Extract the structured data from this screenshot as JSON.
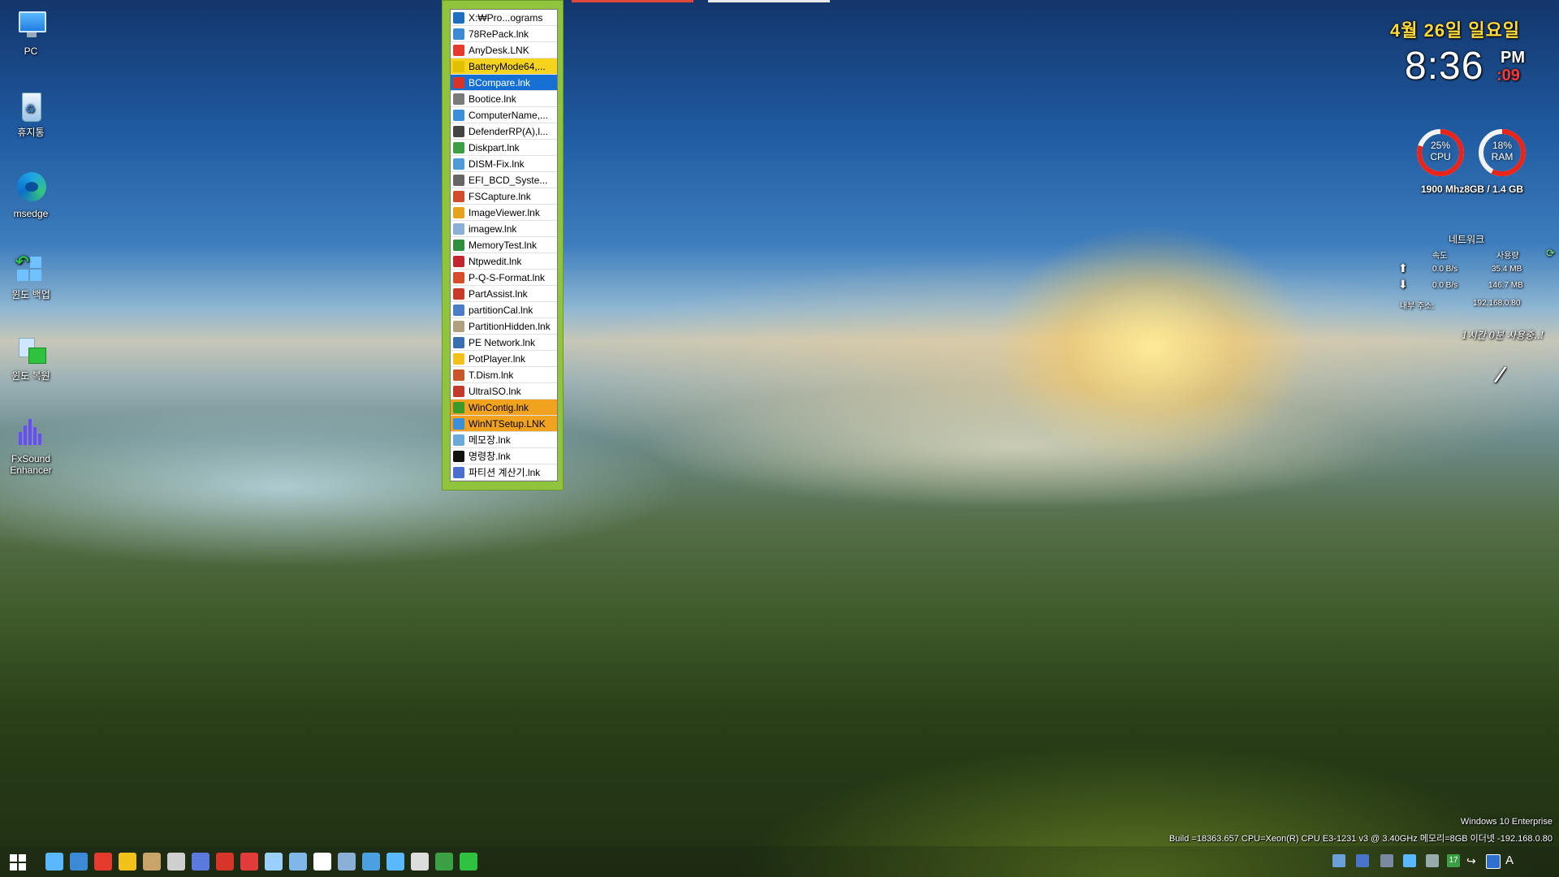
{
  "desktop_icons": [
    {
      "label": "PC",
      "icon": "computer-icon"
    },
    {
      "label": "휴지통",
      "icon": "recycle-bin-icon"
    },
    {
      "label": "msedge",
      "icon": "edge-icon"
    },
    {
      "label": "윈도 백업",
      "icon": "windows-backup-icon"
    },
    {
      "label": "윈도 복원",
      "icon": "windows-restore-icon"
    },
    {
      "label": "FxSound Enhancer",
      "icon": "fxsound-icon"
    }
  ],
  "launcher": {
    "items": [
      {
        "label": "X:₩Pro...ograms",
        "icon": "folder-bl-icon",
        "color": "#1f6fc0",
        "state": "header"
      },
      {
        "label": "78RePack.lnk",
        "icon": "repack-icon",
        "color": "#3c8ad6",
        "state": ""
      },
      {
        "label": "AnyDesk.LNK",
        "icon": "anydesk-icon",
        "color": "#e53b2f",
        "state": ""
      },
      {
        "label": "BatteryMode64,...",
        "icon": "battery-icon",
        "color": "#e0c000",
        "state": "yellow"
      },
      {
        "label": "BCompare.lnk",
        "icon": "bcompare-icon",
        "color": "#d8352a",
        "state": "blue"
      },
      {
        "label": "Bootice.lnk",
        "icon": "bootice-icon",
        "color": "#7a7a7a",
        "state": ""
      },
      {
        "label": "ComputerName,...",
        "icon": "computer-name-icon",
        "color": "#3b8ed8",
        "state": ""
      },
      {
        "label": "DefenderRP(A),l...",
        "icon": "shield-icon",
        "color": "#444444",
        "state": ""
      },
      {
        "label": "Diskpart.lnk",
        "icon": "diskpart-icon",
        "color": "#3aa043",
        "state": ""
      },
      {
        "label": "DISM-Fix.lnk",
        "icon": "dism-icon",
        "color": "#4f9ad8",
        "state": ""
      },
      {
        "label": "EFI_BCD_Syste...",
        "icon": "tools-icon",
        "color": "#666666",
        "state": ""
      },
      {
        "label": "FSCapture.lnk",
        "icon": "fscapture-icon",
        "color": "#d24b2b",
        "state": ""
      },
      {
        "label": "ImageViewer.lnk",
        "icon": "image-viewer-icon",
        "color": "#e6a21c",
        "state": ""
      },
      {
        "label": "imagew.lnk",
        "icon": "imagew-icon",
        "color": "#8ab0d8",
        "state": ""
      },
      {
        "label": "MemoryTest.lnk",
        "icon": "memory-icon",
        "color": "#2f8f3c",
        "state": ""
      },
      {
        "label": "Ntpwedit.lnk",
        "icon": "ntpwedit-icon",
        "color": "#c2272d",
        "state": ""
      },
      {
        "label": "P-Q-S-Format.lnk",
        "icon": "format-icon",
        "color": "#d64d2c",
        "state": ""
      },
      {
        "label": "PartAssist.lnk",
        "icon": "partassist-icon",
        "color": "#c83a2a",
        "state": ""
      },
      {
        "label": "partitionCal.lnk",
        "icon": "partition-cal-icon",
        "color": "#4a7cc8",
        "state": ""
      },
      {
        "label": "PartitionHidden.lnk",
        "icon": "partition-hidden-icon",
        "color": "#b0a080",
        "state": ""
      },
      {
        "label": "PE Network.lnk",
        "icon": "network-icon",
        "color": "#3a6fb0",
        "state": ""
      },
      {
        "label": "PotPlayer.lnk",
        "icon": "potplayer-icon",
        "color": "#f2c21b",
        "state": ""
      },
      {
        "label": "T.Dism.lnk",
        "icon": "tdism-icon",
        "color": "#c9552a",
        "state": ""
      },
      {
        "label": "UltraISO.lnk",
        "icon": "ultraiso-icon",
        "color": "#c23a2a",
        "state": ""
      },
      {
        "label": "WinContig.lnk",
        "icon": "wincontig-icon",
        "color": "#3a9a2a",
        "state": "orange"
      },
      {
        "label": "WinNTSetup.LNK",
        "icon": "winntsetup-icon",
        "color": "#3b8ed8",
        "state": "orange"
      },
      {
        "label": "메모장.lnk",
        "icon": "notepad-icon",
        "color": "#6aa9d8",
        "state": ""
      },
      {
        "label": "명령창.lnk",
        "icon": "cmd-icon",
        "color": "#111111",
        "state": ""
      },
      {
        "label": "파티션 계산기.lnk",
        "icon": "partition-calc-icon",
        "color": "#4a6fd0",
        "state": ""
      }
    ]
  },
  "clock": {
    "date": "4월 26일 일요일",
    "time": "8:36",
    "ampm": "PM",
    "seconds": ":09"
  },
  "system": {
    "cpu": {
      "percent": 25,
      "label": "25%",
      "name": "CPU"
    },
    "ram": {
      "percent": 18,
      "label": "18%",
      "name": "RAM"
    },
    "summary": "1900 Mhz8GB /  1.4 GB"
  },
  "network": {
    "title": "네트워크",
    "col_speed": "속도",
    "col_usage": "사용량",
    "up_speed": "0.0 B/s",
    "up_usage": "35.4 MB",
    "down_speed": "0.0 B/s",
    "down_usage": "146.7 MB",
    "ip_label": "내부 주소:",
    "ip": "192.168.0.80"
  },
  "handwritten_note": "1시간 0분 사용중..!",
  "os_info": {
    "edition": "Windows 10 Enterprise",
    "build": "Build =18363.657  CPU=Xeon(R) CPU E3-1231 v3 @ 3.40GHz 메모리=8GB  이더넷 -192.168.0.80"
  },
  "taskbar": {
    "start_icon": "windows-start-icon",
    "apps": [
      "desktop-icon",
      "pinned-app-icon",
      "anydesk-icon",
      "potplayer-icon",
      "archive-icon",
      "diamond-icon",
      "edge-icon",
      "color-icon",
      "hat-icon",
      "cloud-icon",
      "document-icon",
      "shield-icon",
      "window-icon",
      "picture-icon",
      "computer-icon",
      "tools-icon",
      "h-app-icon",
      "refresh-icon"
    ],
    "tray_badge": "17",
    "ime": "A"
  },
  "colors": {
    "launcher_bg": "#8fc43c",
    "selection_blue": "#1670d4",
    "selection_yellow": "#f6d31c",
    "selection_orange": "#f1a31f",
    "gauge_red": "#e8241b",
    "date_yellow": "#ffd93a",
    "seconds_red": "#ff3a3a"
  }
}
